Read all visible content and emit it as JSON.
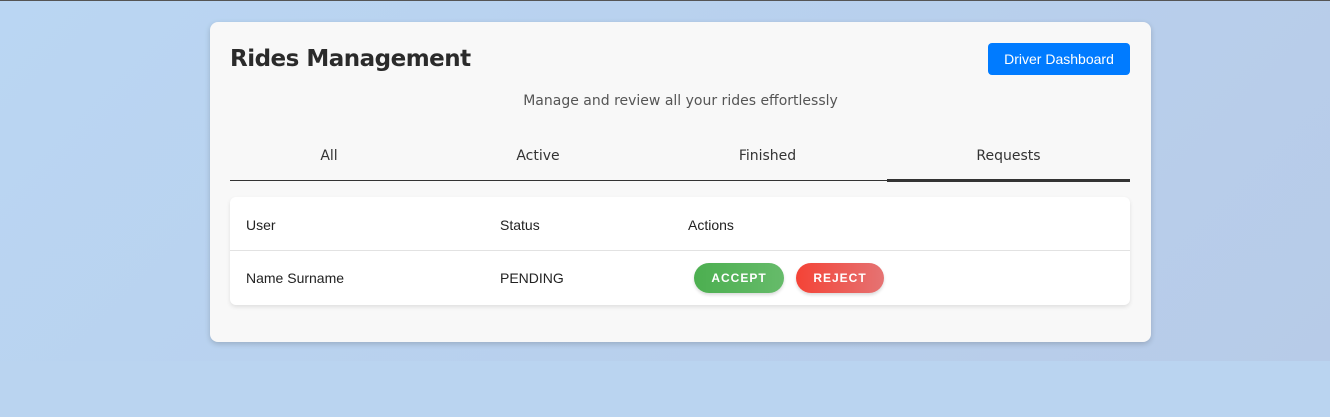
{
  "header": {
    "title": "Rides Management",
    "dashboard_button": "Driver Dashboard",
    "subtitle": "Manage and review all your rides effortlessly"
  },
  "tabs": [
    {
      "label": "All"
    },
    {
      "label": "Active"
    },
    {
      "label": "Finished"
    },
    {
      "label": "Requests",
      "active": true
    }
  ],
  "table": {
    "columns": [
      "User",
      "Status",
      "Actions"
    ],
    "rows": [
      {
        "user": "Name Surname",
        "status": "PENDING",
        "accept": "ACCEPT",
        "reject": "REJECT"
      }
    ]
  },
  "colors": {
    "primary": "#007bff",
    "accept": "#4caf50",
    "reject": "#f44336"
  }
}
